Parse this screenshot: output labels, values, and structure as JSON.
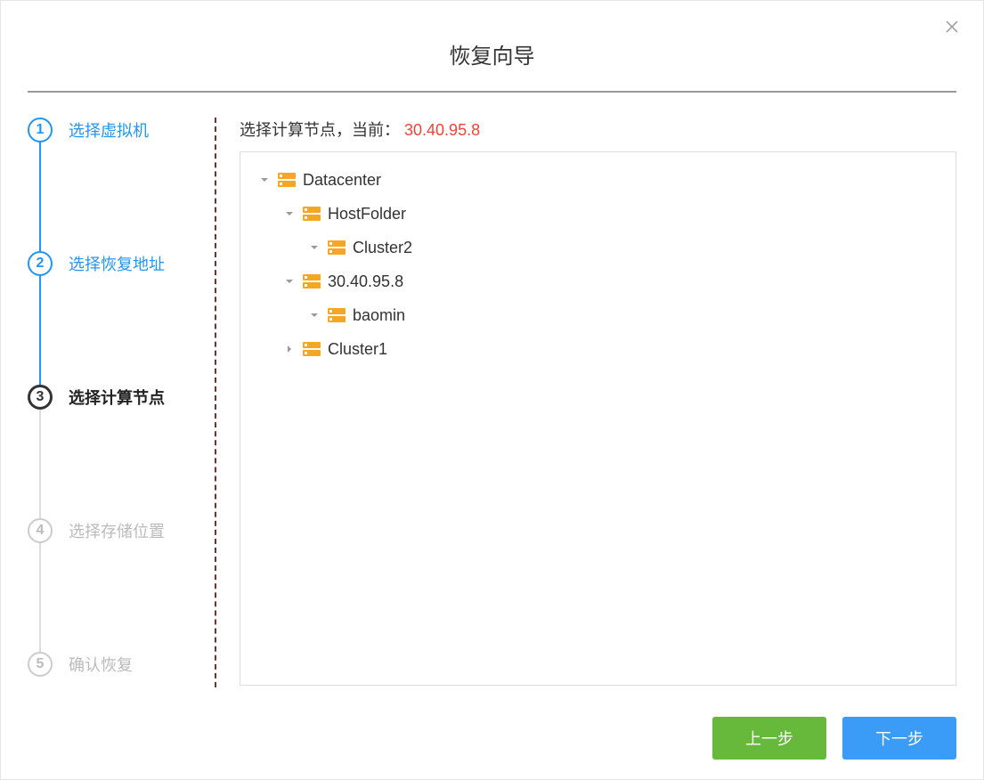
{
  "dialog": {
    "title": "恢复向导"
  },
  "steps": [
    {
      "num": "1",
      "label": "选择虚拟机",
      "state": "done"
    },
    {
      "num": "2",
      "label": "选择恢复地址",
      "state": "done"
    },
    {
      "num": "3",
      "label": "选择计算节点",
      "state": "active"
    },
    {
      "num": "4",
      "label": "选择存储位置",
      "state": "pending"
    },
    {
      "num": "5",
      "label": "确认恢复",
      "state": "pending"
    }
  ],
  "main": {
    "prompt_prefix": "选择计算节点，当前：",
    "current_value": "30.40.95.8",
    "tree": [
      {
        "indent": 0,
        "expanded": true,
        "label": "Datacenter"
      },
      {
        "indent": 1,
        "expanded": true,
        "label": "HostFolder"
      },
      {
        "indent": 2,
        "expanded": true,
        "label": "Cluster2"
      },
      {
        "indent": 1,
        "expanded": true,
        "label": "30.40.95.8"
      },
      {
        "indent": 2,
        "expanded": true,
        "label": "baomin"
      },
      {
        "indent": 1,
        "expanded": false,
        "label": "Cluster1"
      }
    ]
  },
  "footer": {
    "prev": "上一步",
    "next": "下一步"
  }
}
